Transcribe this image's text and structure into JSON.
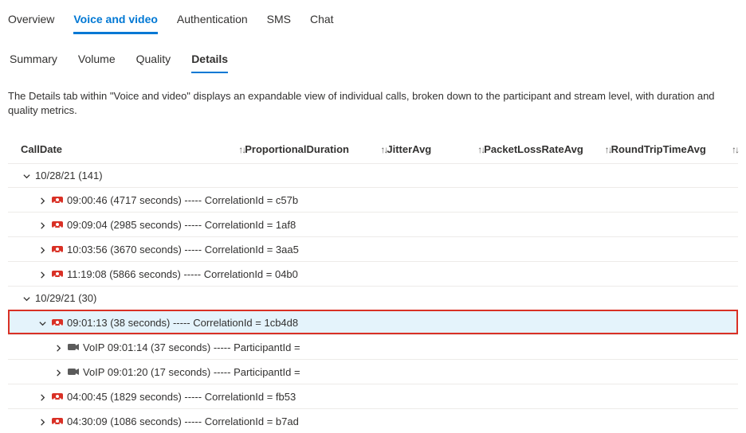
{
  "top_tabs": [
    {
      "label": "Overview",
      "active": false
    },
    {
      "label": "Voice and video",
      "active": true
    },
    {
      "label": "Authentication",
      "active": false
    },
    {
      "label": "SMS",
      "active": false
    },
    {
      "label": "Chat",
      "active": false
    }
  ],
  "sub_tabs": [
    {
      "label": "Summary",
      "active": false
    },
    {
      "label": "Volume",
      "active": false
    },
    {
      "label": "Quality",
      "active": false
    },
    {
      "label": "Details",
      "active": true
    }
  ],
  "description": "The Details tab within \"Voice and video\" displays an expandable view of individual calls, broken down to the participant and stream level, with duration and quality metrics.",
  "columns": {
    "call_date": "CallDate",
    "prop_duration": "ProportionalDuration",
    "jitter": "JitterAvg",
    "packet_loss": "PacketLossRateAvg",
    "rtt": "RoundTripTimeAvg"
  },
  "groups": [
    {
      "label": "10/28/21 (141)",
      "expanded": true,
      "calls": [
        {
          "text": "09:00:46 (4717 seconds) ----- CorrelationId = c57b",
          "expanded": false,
          "selected": false
        },
        {
          "text": "09:09:04 (2985 seconds) ----- CorrelationId = 1af8",
          "expanded": false,
          "selected": false
        },
        {
          "text": "10:03:56 (3670 seconds) ----- CorrelationId = 3aa5",
          "expanded": false,
          "selected": false
        },
        {
          "text": "11:19:08 (5866 seconds) ----- CorrelationId = 04b0",
          "expanded": false,
          "selected": false
        }
      ]
    },
    {
      "label": "10/29/21 (30)",
      "expanded": true,
      "calls": [
        {
          "text": "09:01:13 (38 seconds) ----- CorrelationId = 1cb4d8",
          "expanded": true,
          "selected": true,
          "participants": [
            {
              "text": "VoIP 09:01:14 (37 seconds) ----- ParticipantId ="
            },
            {
              "text": "VoIP 09:01:20 (17 seconds) ----- ParticipantId ="
            }
          ]
        },
        {
          "text": "04:00:45 (1829 seconds) ----- CorrelationId = fb53",
          "expanded": false,
          "selected": false
        },
        {
          "text": "04:30:09 (1086 seconds) ----- CorrelationId = b7ad",
          "expanded": false,
          "selected": false
        }
      ]
    }
  ]
}
